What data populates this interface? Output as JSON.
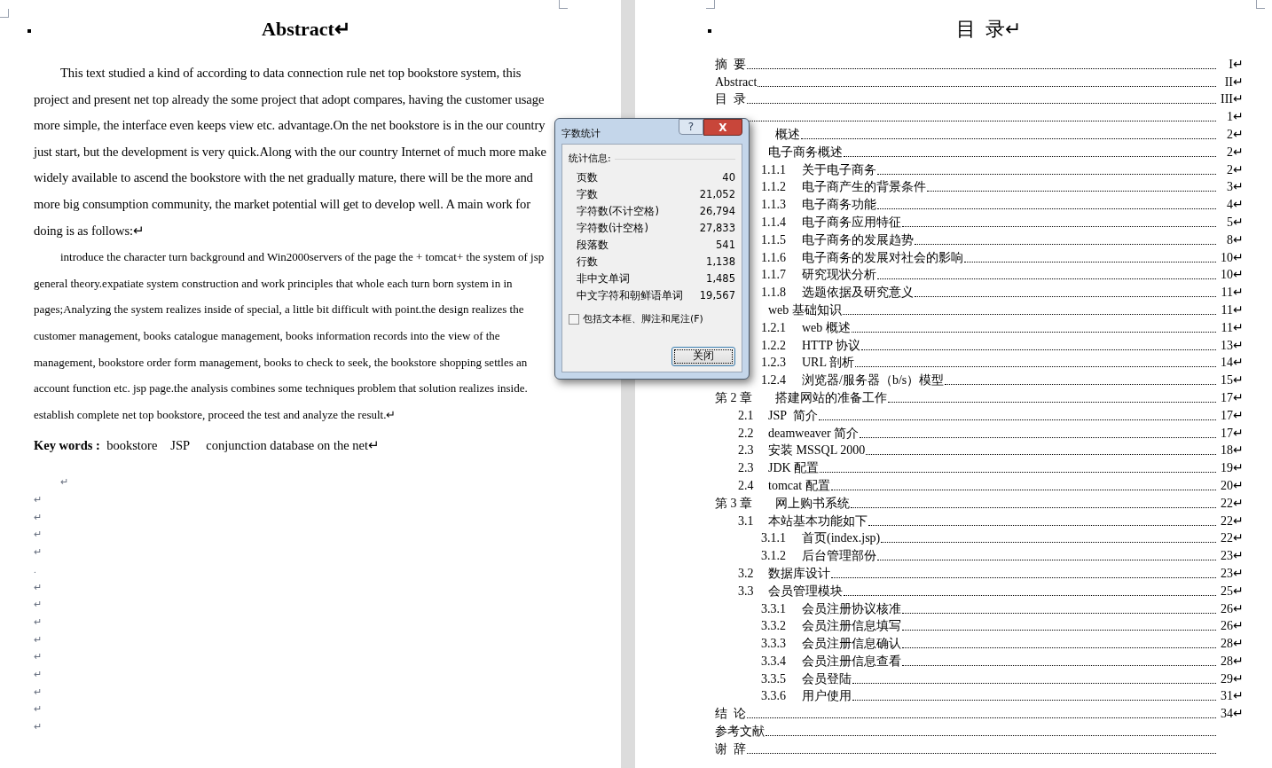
{
  "left_page": {
    "title": "Abstract↵",
    "paragraphs": [
      "This text studied a kind of according to data connection rule net top bookstore system, this project and present net top already the some project that adopt compares, having the customer usage more simple, the interface even keeps view etc. advantage.On the net bookstore is in the our country just start, but the development is very quick.Along with the our country Internet of much more make widely available to ascend the bookstore with the net gradually mature, there will be the more and more big consumption community, the market potential will get to develop well. A main work for doing is as follows:↵",
      "introduce the character turn background and Win2000servers of the page the + tomcat+ the system of jsp general theory.expatiate system construction and work principles that whole each turn born system in in pages;Analyzing the system realizes inside of special, a little bit difficult with point.the design realizes the customer management, books catalogue management, books information records into the view of the management, bookstore order form management, books to check to seek, the bookstore shopping settles an account function etc. jsp page.the analysis combines some techniques problem that solution realizes inside. establish complete net top bookstore, proceed the test and analyze the result.↵"
    ],
    "keywords": "**Key words :**  bookstore　JSP　 conjunction database on the net↵",
    "empty_marks": [
      "↵",
      "↵",
      "↵",
      "↵",
      "↵",
      ".",
      "↵",
      "↵",
      "↵",
      "↵",
      "↵",
      "↵",
      "↵",
      "↵",
      "↵"
    ]
  },
  "right_page": {
    "title": "目  录↵",
    "toc": [
      {
        "number": "摘  要",
        "page": "I↵"
      },
      {
        "number": "Abstract",
        "page": "II↵"
      },
      {
        "number": "目  录",
        "page": "III↵"
      },
      {
        "page": "1↵"
      },
      {
        "title": "概述",
        "page": "2↵",
        "children": [
          {
            "title": "电子商务概述",
            "page": "2↵",
            "children": [
              {
                "number": "1.1.1",
                "title": "关于电子商务",
                "page": "2↵"
              },
              {
                "number": "1.1.2",
                "title": "电子商产生的背景条件",
                "page": "3↵"
              },
              {
                "number": "1.1.3",
                "title": "电子商务功能",
                "page": "4↵"
              },
              {
                "number": "1.1.4",
                "title": "电子商务应用特征",
                "page": "5↵"
              },
              {
                "number": "1.1.5",
                "title": "电子商务的发展趋势",
                "page": "8↵"
              },
              {
                "number": "1.1.6",
                "title": "电子商务的发展对社会的影响",
                "page": "10↵"
              },
              {
                "number": "1.1.7",
                "title": "研究现状分析",
                "page": "10↵"
              },
              {
                "number": "1.1.8",
                "title": "选题依据及研究意义",
                "page": "11↵"
              }
            ]
          },
          {
            "title": "web 基础知识",
            "page": "11↵",
            "children": [
              {
                "number": "1.2.1",
                "title": "web 概述",
                "page": "11↵"
              },
              {
                "number": "1.2.2",
                "title": "HTTP 协议",
                "page": "13↵"
              },
              {
                "number": "1.2.3",
                "title": "URL 剖析",
                "page": "14↵"
              },
              {
                "number": "1.2.4",
                "title": "浏览器/服务器（b/s）模型",
                "page": "15↵"
              }
            ]
          }
        ]
      },
      {
        "number": "第 2 章",
        "title": "搭建网站的准备工作",
        "page": "17↵",
        "children": [
          {
            "number": "2.1",
            "title": "JSP  简介",
            "page": "17↵"
          },
          {
            "number": "2.2",
            "title": "deamweaver 简介",
            "page": "17↵"
          },
          {
            "number": "2.3",
            "title": "安装 MSSQL 2000",
            "page": "18↵"
          },
          {
            "number": "2.3",
            "title": "JDK 配置",
            "page": "19↵"
          },
          {
            "number": "2.4",
            "title": "tomcat 配置",
            "page": "20↵"
          }
        ]
      },
      {
        "number": "第 3 章",
        "title": "网上购书系统",
        "page": "22↵",
        "children": [
          {
            "number": "3.1",
            "title": "本站基本功能如下",
            "page": "22↵",
            "children": [
              {
                "number": "3.1.1",
                "title": "首页(index.jsp)",
                "page": "22↵"
              },
              {
                "number": "3.1.2",
                "title": "后台管理部份",
                "page": "23↵"
              }
            ]
          },
          {
            "number": "3.2",
            "title": "数据库设计",
            "page": "23↵"
          },
          {
            "number": "3.3",
            "title": "会员管理模块",
            "page": "25↵",
            "children": [
              {
                "number": "3.3.1",
                "title": "会员注册协议核准",
                "page": "26↵"
              },
              {
                "number": "3.3.2",
                "title": "会员注册信息填写",
                "page": "26↵"
              },
              {
                "number": "3.3.3",
                "title": "会员注册信息确认",
                "page": "28↵"
              },
              {
                "number": "3.3.4",
                "title": "会员注册信息查看",
                "page": "28↵"
              },
              {
                "number": "3.3.5",
                "title": "会员登陆",
                "page": "29↵"
              },
              {
                "number": "3.3.6",
                "title": "用户使用",
                "page": "31↵"
              }
            ]
          }
        ]
      },
      {
        "number": "结  论",
        "page": "34↵"
      },
      {
        "number": "参考文献"
      },
      {
        "number": "谢  辞"
      }
    ]
  },
  "dialog": {
    "title": "字数统计",
    "help": "?",
    "close": "X",
    "section": "统计信息:",
    "stats": [
      {
        "label": "页数",
        "value": "40"
      },
      {
        "label": "字数",
        "value": "21,052"
      },
      {
        "label": "字符数(不计空格)",
        "value": "26,794"
      },
      {
        "label": "字符数(计空格)",
        "value": "27,833"
      },
      {
        "label": "段落数",
        "value": "541"
      },
      {
        "label": "行数",
        "value": "1,138"
      },
      {
        "label": "非中文单词",
        "value": "1,485"
      },
      {
        "label": "中文字符和朝鲜语单词",
        "value": "19,567"
      }
    ],
    "checkbox": {
      "label": "包括文本框、脚注和尾注(F)",
      "checked": false
    },
    "button": "关闭"
  }
}
